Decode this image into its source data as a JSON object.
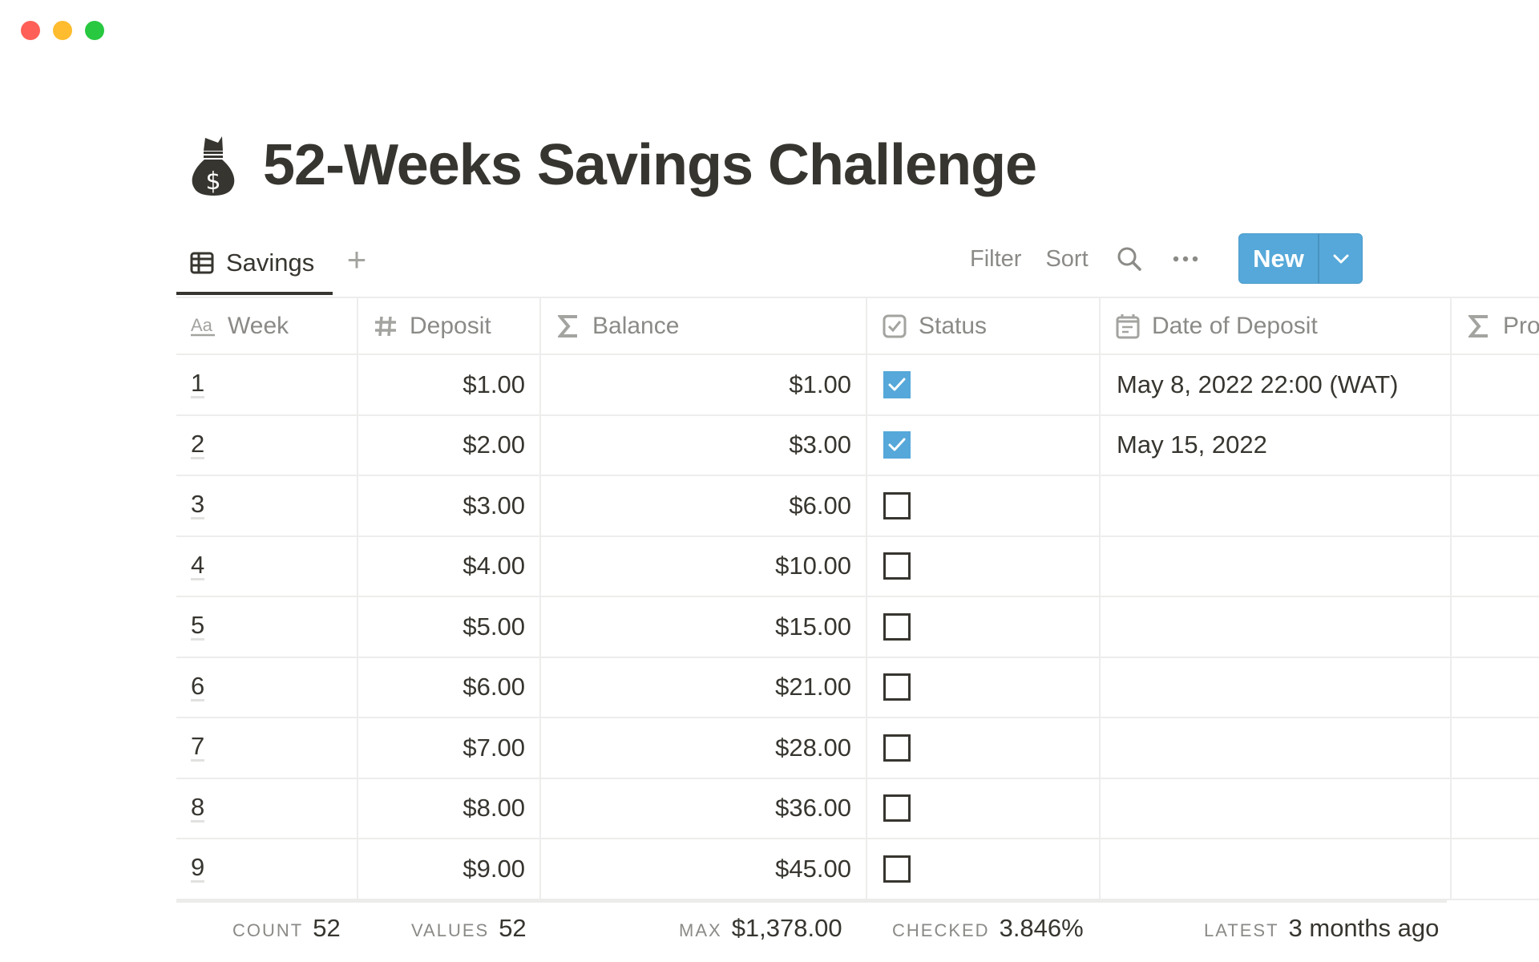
{
  "window": {
    "traffic_lights": [
      {
        "name": "close",
        "color": "#ff5f57"
      },
      {
        "name": "minimize",
        "color": "#febc2e"
      },
      {
        "name": "maximize",
        "color": "#28c840"
      }
    ]
  },
  "page": {
    "icon": "money-bag-icon",
    "title": "52-Weeks Savings Challenge"
  },
  "views": {
    "tabs": [
      {
        "label": "Savings",
        "icon": "table-icon",
        "active": true
      }
    ],
    "add_view_icon": "plus-icon"
  },
  "toolbar": {
    "filter_label": "Filter",
    "sort_label": "Sort",
    "search_icon": "search-icon",
    "more_icon": "more-horizontal-icon",
    "new_label": "New",
    "new_dropdown_icon": "chevron-down-icon",
    "accent": "#55a8d9"
  },
  "table": {
    "columns": [
      {
        "label": "Week",
        "icon": "title-text-icon"
      },
      {
        "label": "Deposit",
        "icon": "number-hash-icon"
      },
      {
        "label": "Balance",
        "icon": "formula-sigma-icon"
      },
      {
        "label": "Status",
        "icon": "checkbox-icon"
      },
      {
        "label": "Date of Deposit",
        "icon": "calendar-icon"
      },
      {
        "label": "Pro",
        "icon": "formula-sigma-icon"
      }
    ],
    "rows": [
      {
        "week": "1",
        "deposit": "$1.00",
        "balance": "$1.00",
        "status": true,
        "date": "May 8, 2022 22:00 (WAT)"
      },
      {
        "week": "2",
        "deposit": "$2.00",
        "balance": "$3.00",
        "status": true,
        "date": "May 15, 2022"
      },
      {
        "week": "3",
        "deposit": "$3.00",
        "balance": "$6.00",
        "status": false,
        "date": ""
      },
      {
        "week": "4",
        "deposit": "$4.00",
        "balance": "$10.00",
        "status": false,
        "date": ""
      },
      {
        "week": "5",
        "deposit": "$5.00",
        "balance": "$15.00",
        "status": false,
        "date": ""
      },
      {
        "week": "6",
        "deposit": "$6.00",
        "balance": "$21.00",
        "status": false,
        "date": ""
      },
      {
        "week": "7",
        "deposit": "$7.00",
        "balance": "$28.00",
        "status": false,
        "date": ""
      },
      {
        "week": "8",
        "deposit": "$8.00",
        "balance": "$36.00",
        "status": false,
        "date": ""
      },
      {
        "week": "9",
        "deposit": "$9.00",
        "balance": "$45.00",
        "status": false,
        "date": ""
      }
    ]
  },
  "footer": {
    "count": {
      "label": "COUNT",
      "value": "52"
    },
    "values": {
      "label": "VALUES",
      "value": "52"
    },
    "max": {
      "label": "MAX",
      "value": "$1,378.00"
    },
    "checked": {
      "label": "CHECKED",
      "value": "3.846%"
    },
    "latest": {
      "label": "LATEST",
      "value": "3 months ago"
    }
  }
}
